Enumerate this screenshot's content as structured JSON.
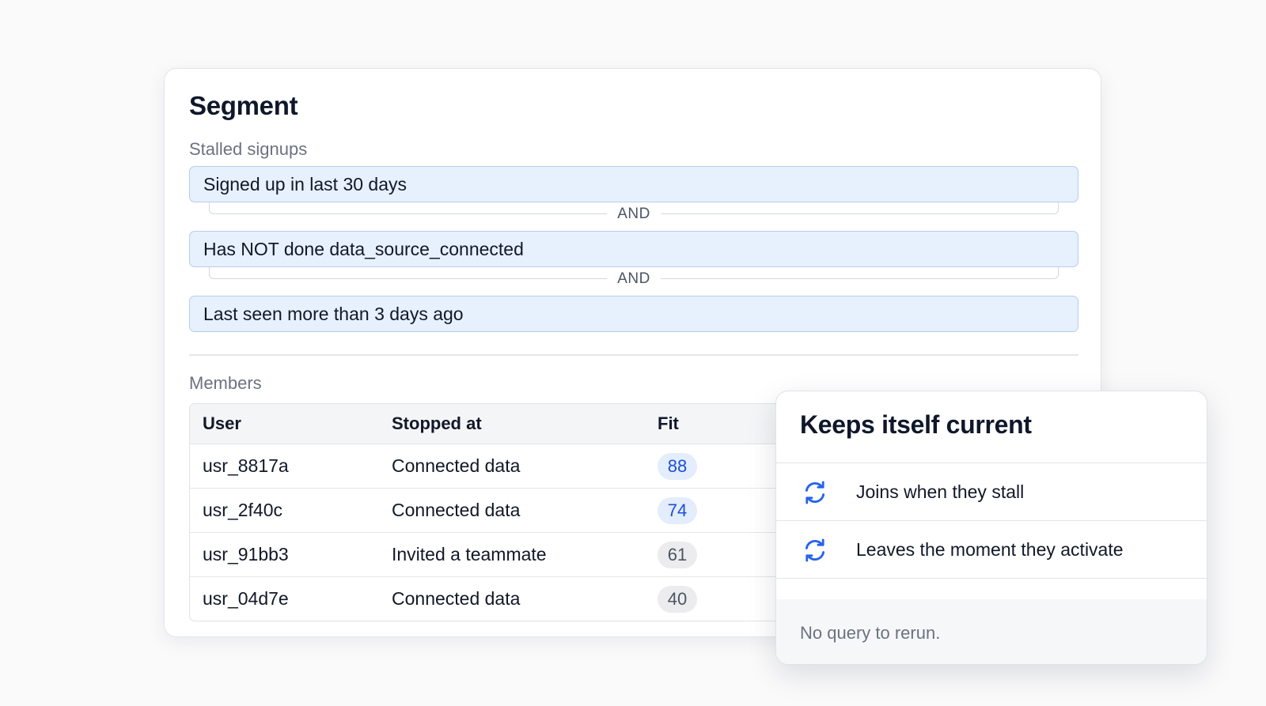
{
  "segment": {
    "title": "Segment",
    "group_label": "Stalled signups",
    "conditions": [
      "Signed up in last 30 days",
      "Has NOT done data_source_connected",
      "Last seen more than 3 days ago"
    ],
    "operators": [
      "AND",
      "AND"
    ]
  },
  "members": {
    "label": "Members",
    "columns": [
      "User",
      "Stopped at",
      "Fit"
    ],
    "rows": [
      {
        "user": "usr_8817a",
        "stopped_at": "Connected data",
        "fit": "88",
        "fit_level": "high"
      },
      {
        "user": "usr_2f40c",
        "stopped_at": "Connected data",
        "fit": "74",
        "fit_level": "high"
      },
      {
        "user": "usr_91bb3",
        "stopped_at": "Invited a teammate",
        "fit": "61",
        "fit_level": "low"
      },
      {
        "user": "usr_04d7e",
        "stopped_at": "Connected data",
        "fit": "40",
        "fit_level": "low"
      }
    ]
  },
  "current_card": {
    "title": "Keeps itself current",
    "features": [
      {
        "icon": "refresh-icon",
        "text": "Joins when they stall"
      },
      {
        "icon": "refresh-icon",
        "text": "Leaves the moment they activate"
      }
    ],
    "footer": "No query to rerun."
  },
  "colors": {
    "accent_blue": "#2563eb",
    "condition_fill": "#e7f0fd",
    "condition_border": "#b6cdee",
    "fit_high_bg": "#e3edfc",
    "fit_high_text": "#1d4ed8",
    "fit_low_bg": "#ececee"
  }
}
